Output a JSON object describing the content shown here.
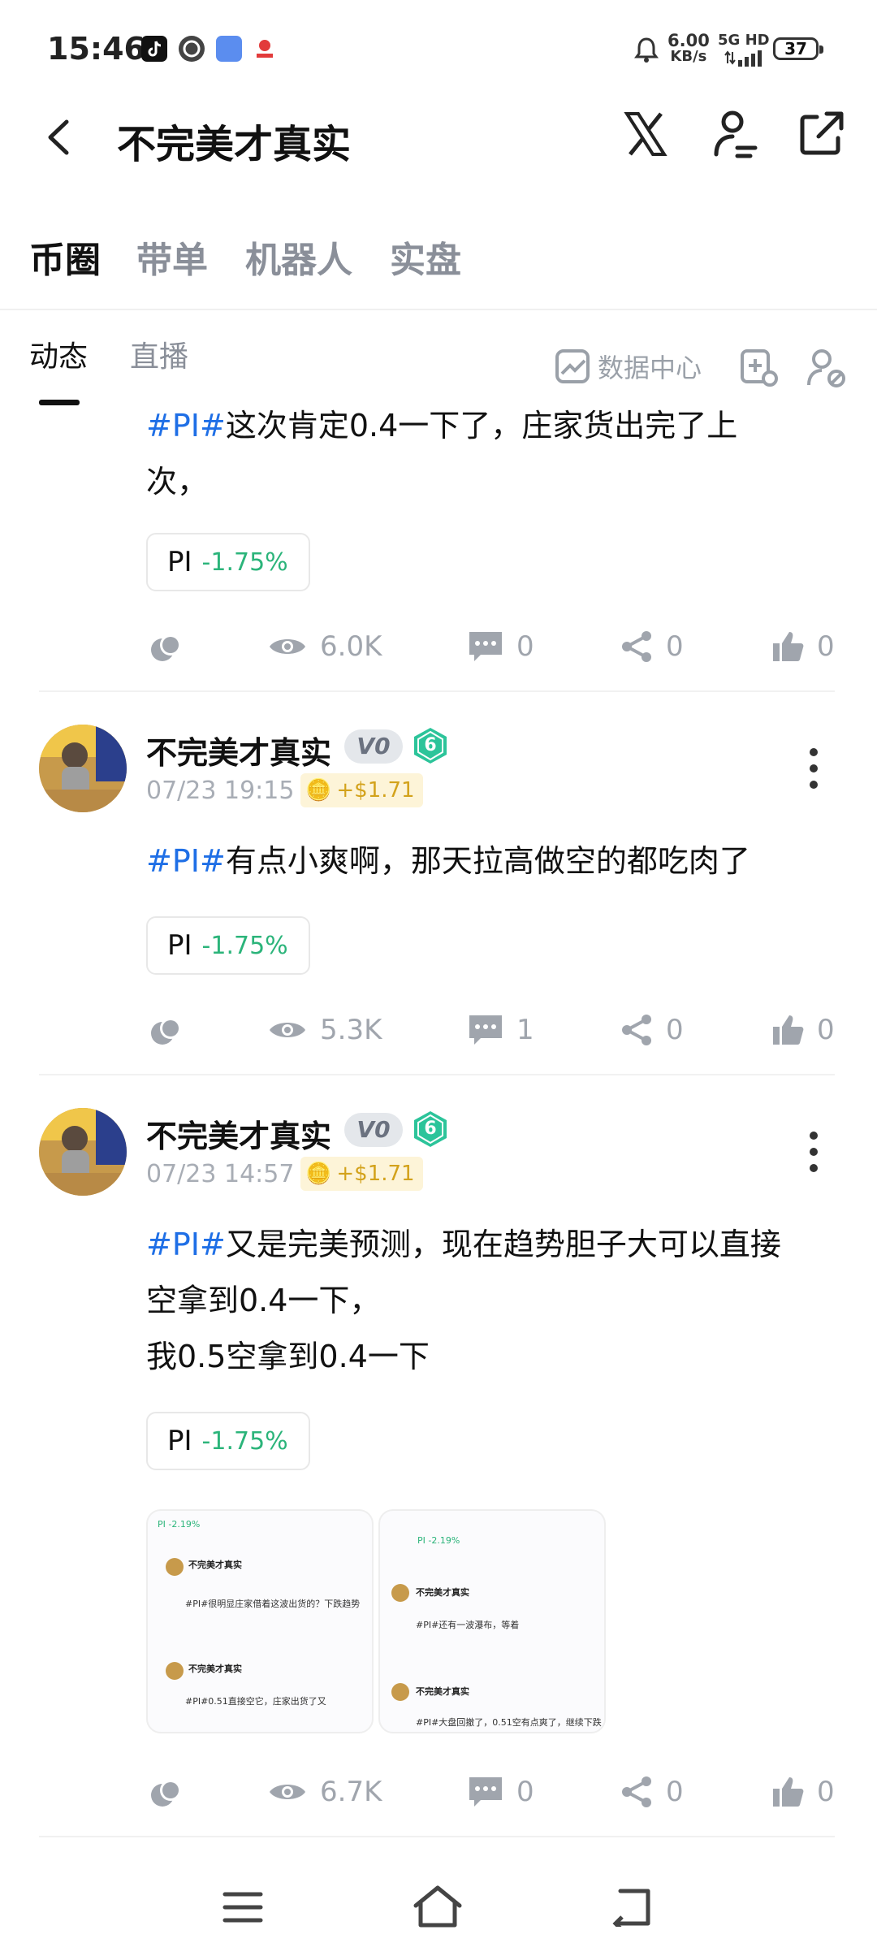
{
  "status_bar": {
    "time": "15:46",
    "speed_value": "6.00",
    "speed_unit": "KB/s",
    "network": "5G HD",
    "battery": "37"
  },
  "header": {
    "title": "不完美才真实"
  },
  "tabs": [
    {
      "label": "币圈",
      "active": true
    },
    {
      "label": "带单",
      "active": false
    },
    {
      "label": "机器人",
      "active": false
    },
    {
      "label": "实盘",
      "active": false
    }
  ],
  "subtabs": [
    {
      "label": "动态",
      "active": true
    },
    {
      "label": "直播",
      "active": false
    }
  ],
  "tools": {
    "data_center": "数据中心"
  },
  "posts": [
    {
      "hashtag": "#PI#",
      "text_lines": [
        "这次肯定0.4一下了，庄家货出完了上",
        "次，"
      ],
      "chip": {
        "symbol": "PI",
        "change": "-1.75%"
      },
      "stats": {
        "views": "6.0K",
        "comments": "0",
        "shares": "0",
        "likes": "0"
      }
    },
    {
      "author": "不完美才真实",
      "vip": "V0",
      "level": "6",
      "date": "07/23 19:15",
      "profit": "+$1.71",
      "hashtag": "#PI#",
      "text_lines": [
        "有点小爽啊，那天拉高做空的都吃肉了"
      ],
      "chip": {
        "symbol": "PI",
        "change": "-1.75%"
      },
      "stats": {
        "views": "5.3K",
        "comments": "1",
        "shares": "0",
        "likes": "0"
      }
    },
    {
      "author": "不完美才真实",
      "vip": "V0",
      "level": "6",
      "date": "07/23 14:57",
      "profit": "+$1.71",
      "hashtag": "#PI#",
      "text_lines": [
        "又是完美预测，现在趋势胆子大可以直接",
        "空拿到0.4一下，",
        "我0.5空拿到0.4一下"
      ],
      "chip": {
        "symbol": "PI",
        "change": "-1.75%"
      },
      "images": [
        {
          "rows": [
            {
              "author": "不完美才真实",
              "text": "#PI#很明显庄家借着这波出货的？下跌趋势"
            },
            {
              "author": "不完美才真实",
              "text": "#PI#0.51直接空它，庄家出货了又"
            }
          ],
          "chip": "PI -2.19%"
        },
        {
          "rows": [
            {
              "author": "不完美才真实",
              "text": "#PI#还有一波瀑布，等着"
            },
            {
              "author": "不完美才真实",
              "text": "#PI#大盘回撤了，0.51空有点爽了，继续下跌"
            }
          ],
          "chip": "PI -2.19%"
        }
      ],
      "stats": {
        "views": "6.7K",
        "comments": "0",
        "shares": "0",
        "likes": "0"
      }
    }
  ]
}
